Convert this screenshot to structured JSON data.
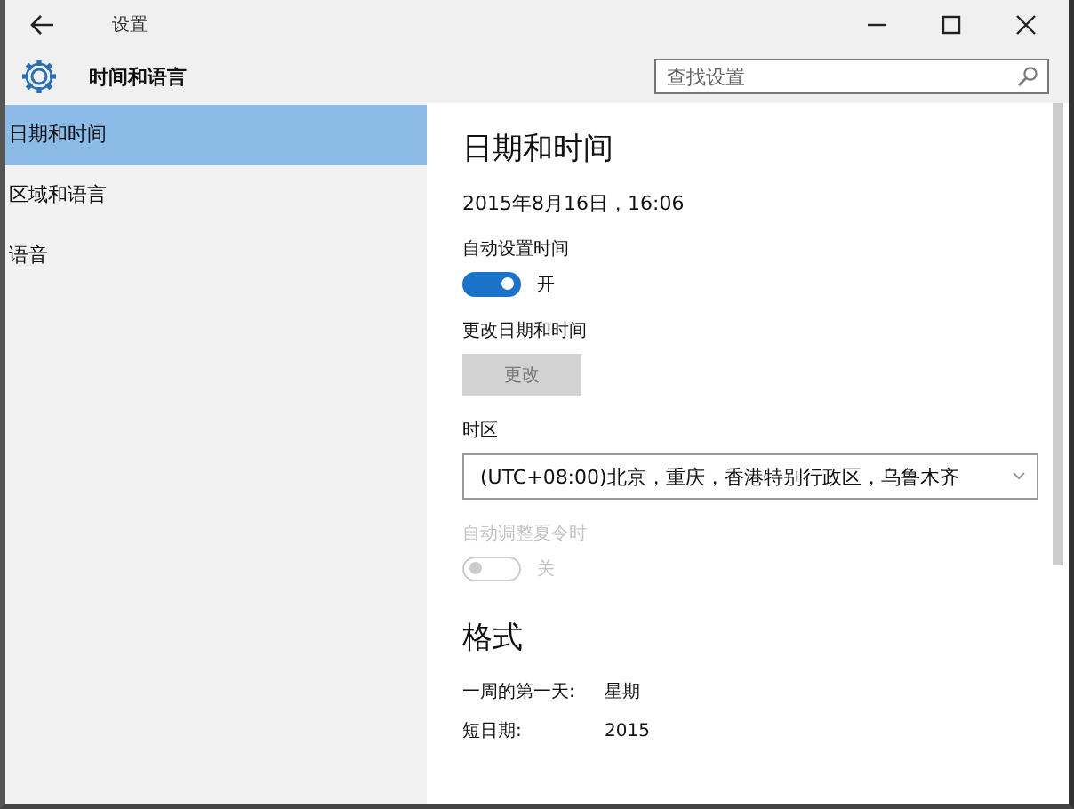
{
  "window": {
    "title": "设置"
  },
  "header": {
    "title": "时间和语言",
    "search": {
      "placeholder": "查找设置"
    }
  },
  "sidebar": {
    "items": [
      {
        "label": "日期和时间",
        "selected": true
      },
      {
        "label": "区域和语言",
        "selected": false
      },
      {
        "label": "语音",
        "selected": false
      }
    ]
  },
  "content": {
    "heading": "日期和时间",
    "current_datetime": "2015年8月16日，16:06",
    "settings": [
      {
        "kind": "toggle",
        "label": "自动设置时间",
        "on": true,
        "state_text": "开"
      },
      {
        "kind": "button",
        "label": "更改日期和时间",
        "button": "更改",
        "disabled": true
      },
      {
        "kind": "dropdown",
        "label": "时区",
        "value": "(UTC+08:00)北京，重庆，香港特别行政区，乌鲁木齐"
      },
      {
        "kind": "toggle",
        "label": "自动调整夏令时",
        "on": false,
        "disabled": true,
        "state_text": "关"
      }
    ],
    "format": {
      "heading": "格式",
      "rows": [
        {
          "label": "一周的第一天:",
          "value": "星期"
        },
        {
          "label": "短日期:",
          "value": "2015"
        }
      ]
    }
  }
}
